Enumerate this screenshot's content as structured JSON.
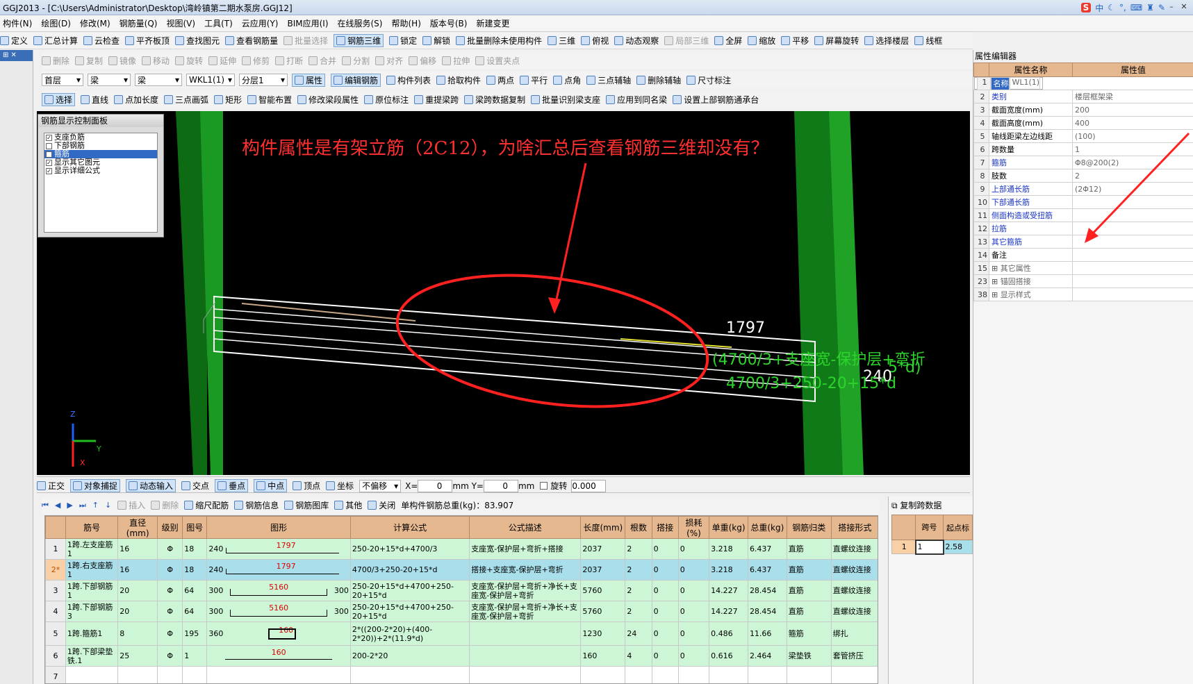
{
  "window": {
    "title": "GGJ2013 - [C:\\Users\\Administrator\\Desktop\\湾岭镇第二期水泵房.GGJ12]"
  },
  "tray": {
    "cn": "中",
    "s": "S"
  },
  "menu": [
    "构件(N)",
    "绘图(D)",
    "修改(M)",
    "钢筋量(Q)",
    "视图(V)",
    "工具(T)",
    "云应用(Y)",
    "BIM应用(I)",
    "在线服务(S)",
    "帮助(H)",
    "版本号(B)",
    "新建变更"
  ],
  "toolbar1": [
    "定义",
    "汇总计算",
    "云检查",
    "平齐板顶",
    "查找图元",
    "查看钢筋量",
    "批量选择",
    "钢筋三维",
    "锁定",
    "解锁",
    "批量删除未使用构件",
    "三维",
    "俯视",
    "动态观察",
    "局部三维",
    "全屏",
    "缩放",
    "平移",
    "屏幕旋转",
    "选择楼层",
    "线框"
  ],
  "toolbar2": [
    "删除",
    "复制",
    "镜像",
    "移动",
    "旋转",
    "延伸",
    "修剪",
    "打断",
    "合并",
    "分割",
    "对齐",
    "偏移",
    "拉伸",
    "设置夹点"
  ],
  "toolbar3": {
    "floor": "首层",
    "type1": "梁",
    "type2": "梁",
    "member": "WKL1(1)",
    "layer": "分层1",
    "items": [
      "属性",
      "编辑钢筋",
      "构件列表",
      "拾取构件",
      "两点",
      "平行",
      "点角",
      "三点辅轴",
      "删除辅轴",
      "尺寸标注"
    ]
  },
  "toolbar4": [
    "选择",
    "直线",
    "点加长度",
    "三点画弧",
    "矩形",
    "智能布置",
    "修改梁段属性",
    "原位标注",
    "重提梁跨",
    "梁跨数据复制",
    "批量识别梁支座",
    "应用到同名梁",
    "设置上部钢筋通承台"
  ],
  "control_panel": {
    "title": "钢筋显示控制面板",
    "items": [
      {
        "label": "支座负筋",
        "checked": "✓"
      },
      {
        "label": "下部钢筋",
        "checked": ""
      },
      {
        "label": "箍筋",
        "checked": ""
      },
      {
        "label": "显示其它图元",
        "checked": "✓"
      },
      {
        "label": "显示详细公式",
        "checked": "✓"
      }
    ]
  },
  "viewport": {
    "question": "构件属性是有架立筋（2C12），为啥汇总后查看钢筋三维却没有？",
    "dim1": "1797",
    "dim2": "(4700/3+支座宽-保护层+弯折",
    "dim3": "240",
    "dim4": "4700/3+250-20+15*d",
    "dim5": "5*d)"
  },
  "snapbar": {
    "items": [
      "正交",
      "对象捕捉",
      "动态输入",
      "交点",
      "垂点",
      "中点",
      "顶点",
      "坐标"
    ],
    "offset": "不偏移",
    "x_label": "X=",
    "x_val": "0",
    "y_label": "mm Y=",
    "y_val": "0",
    "mm": "mm",
    "rot": "旋转",
    "rot_val": "0.000"
  },
  "table_toolbar": {
    "items": [
      "插入",
      "删除",
      "缩尺配筋",
      "钢筋信息",
      "钢筋图库",
      "其他",
      "关闭"
    ],
    "weight": "单构件钢筋总重(kg)：83.907"
  },
  "rebar_table": {
    "headers": [
      "筋号",
      "直径(mm)",
      "级别",
      "图号",
      "图形",
      "计算公式",
      "公式描述",
      "长度(mm)",
      "根数",
      "搭接",
      "损耗(%)",
      "单重(kg)",
      "总重(kg)",
      "钢筋归类",
      "搭接形式"
    ],
    "rows": [
      {
        "n": "1",
        "name": "1跨.左支座筋1",
        "d": "16",
        "lv": "Φ",
        "fig": "18",
        "s1": "240",
        "s2": "1797",
        "s3": "",
        "f": "250-20+15*d+4700/3",
        "desc": "支座宽-保护层+弯折+搭接",
        "len": "2037",
        "cnt": "2",
        "lap": "0",
        "loss": "0",
        "uw": "3.218",
        "tw": "6.437",
        "cat": "直筋",
        "form": "直螺纹连接"
      },
      {
        "n": "2*",
        "name": "1跨.右支座筋1",
        "d": "16",
        "lv": "Φ",
        "fig": "18",
        "s1": "240",
        "s2": "1797",
        "s3": "",
        "f": "4700/3+250-20+15*d",
        "desc": "搭接+支座宽-保护层+弯折",
        "len": "2037",
        "cnt": "2",
        "lap": "0",
        "loss": "0",
        "uw": "3.218",
        "tw": "6.437",
        "cat": "直筋",
        "form": "直螺纹连接"
      },
      {
        "n": "3",
        "name": "1跨.下部钢筋1",
        "d": "20",
        "lv": "Φ",
        "fig": "64",
        "s1": "300",
        "s2": "5160",
        "s3": "300",
        "f": "250-20+15*d+4700+250-20+15*d",
        "desc": "支座宽-保护层+弯折+净长+支座宽-保护层+弯折",
        "len": "5760",
        "cnt": "2",
        "lap": "0",
        "loss": "0",
        "uw": "14.227",
        "tw": "28.454",
        "cat": "直筋",
        "form": "直螺纹连接"
      },
      {
        "n": "4",
        "name": "1跨.下部钢筋3",
        "d": "20",
        "lv": "Φ",
        "fig": "64",
        "s1": "300",
        "s2": "5160",
        "s3": "300",
        "f": "250-20+15*d+4700+250-20+15*d",
        "desc": "支座宽-保护层+弯折+净长+支座宽-保护层+弯折",
        "len": "5760",
        "cnt": "2",
        "lap": "0",
        "loss": "0",
        "uw": "14.227",
        "tw": "28.454",
        "cat": "直筋",
        "form": "直螺纹连接"
      },
      {
        "n": "5",
        "name": "1跨.箍筋1",
        "d": "8",
        "lv": "Φ",
        "fig": "195",
        "s1": "360",
        "s2": "160",
        "s3": "",
        "f": "2*((200-2*20)+(400-2*20))+2*(11.9*d)",
        "desc": "",
        "len": "1230",
        "cnt": "24",
        "lap": "0",
        "loss": "0",
        "uw": "0.486",
        "tw": "11.66",
        "cat": "箍筋",
        "form": "绑扎"
      },
      {
        "n": "6",
        "name": "1跨.下部梁垫铁.1",
        "d": "25",
        "lv": "Φ",
        "fig": "1",
        "s1": "",
        "s2": "160",
        "s3": "",
        "f": "200-2*20",
        "desc": "",
        "len": "160",
        "cnt": "4",
        "lap": "0",
        "loss": "0",
        "uw": "0.616",
        "tw": "2.464",
        "cat": "梁垫铁",
        "form": "套管挤压"
      },
      {
        "n": "7",
        "name": "",
        "d": "",
        "lv": "",
        "fig": "",
        "s1": "",
        "s2": "",
        "s3": "",
        "f": "",
        "desc": "",
        "len": "",
        "cnt": "",
        "lap": "",
        "loss": "",
        "uw": "",
        "tw": "",
        "cat": "",
        "form": ""
      }
    ]
  },
  "properties": {
    "title": "属性编辑器",
    "h_name": "属性名称",
    "h_value": "属性值",
    "rows": [
      {
        "n": "1",
        "k": "名称",
        "v": "WL1(1)"
      },
      {
        "n": "2",
        "k": "类别",
        "v": "楼层框架梁"
      },
      {
        "n": "3",
        "k": "截面宽度(mm)",
        "v": "200"
      },
      {
        "n": "4",
        "k": "截面高度(mm)",
        "v": "400"
      },
      {
        "n": "5",
        "k": "轴线距梁左边线距",
        "v": "(100)"
      },
      {
        "n": "6",
        "k": "跨数量",
        "v": "1"
      },
      {
        "n": "7",
        "k": "箍筋",
        "v": "Φ8@200(2)"
      },
      {
        "n": "8",
        "k": "肢数",
        "v": "2"
      },
      {
        "n": "9",
        "k": "上部通长筋",
        "v": "(2Φ12)"
      },
      {
        "n": "10",
        "k": "下部通长筋",
        "v": ""
      },
      {
        "n": "11",
        "k": "侧面构造或受扭筋",
        "v": ""
      },
      {
        "n": "12",
        "k": "拉筋",
        "v": ""
      },
      {
        "n": "13",
        "k": "其它箍筋",
        "v": ""
      },
      {
        "n": "14",
        "k": "备注",
        "v": ""
      },
      {
        "n": "15",
        "k": "其它属性",
        "v": ""
      },
      {
        "n": "23",
        "k": "锚固搭接",
        "v": ""
      },
      {
        "n": "38",
        "k": "显示样式",
        "v": ""
      }
    ]
  },
  "span_panel": {
    "title": "复制跨数据",
    "h1": "跨号",
    "h2": "起点标",
    "r1": "1",
    "v1": "1",
    "v2": "2.58"
  },
  "colors": {
    "accent": "#316ac5",
    "table_green": "#ccf6d5",
    "table_blue": "#a9dfea",
    "header": "#e6b890",
    "annotation": "#ff2020"
  }
}
